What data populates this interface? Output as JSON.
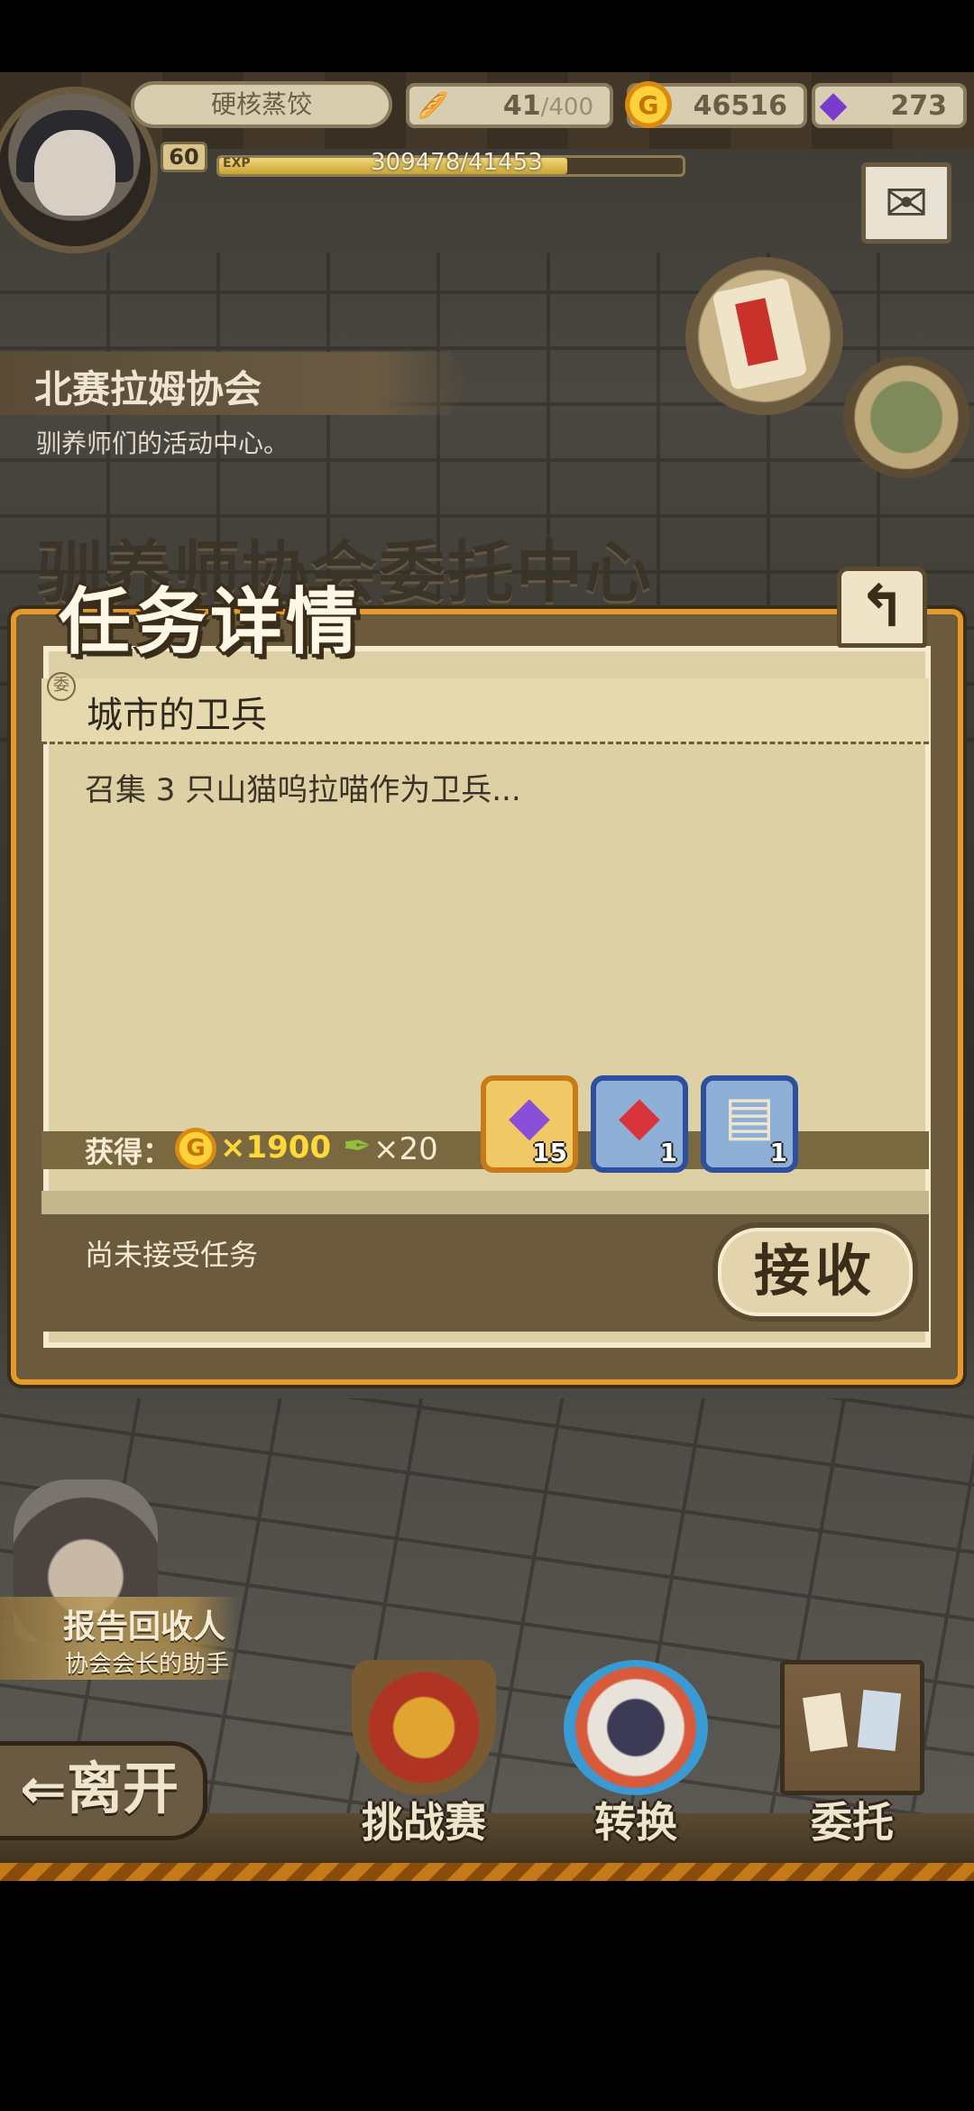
{
  "player": {
    "name": "硬核蒸饺",
    "level": "60",
    "exp_label": "EXP",
    "exp_text": "309478/41453",
    "exp_fraction": 0.75
  },
  "resources": {
    "stamina": {
      "icon": "bread-icon",
      "value": "41",
      "max": "/400"
    },
    "gold": {
      "icon": "gold-coin-icon",
      "symbol": "G",
      "value": "46516"
    },
    "gems": {
      "icon": "purple-gem-icon",
      "value": "273"
    }
  },
  "location": {
    "title": "北赛拉姆协会",
    "subtitle": "驯养师们的活动中心。"
  },
  "background_title": "驯养师协会委托中心",
  "dialog": {
    "title": "任务详情",
    "back_icon": "↰",
    "quest_icon": "委",
    "quest_name": "城市的卫兵",
    "quest_description": "召集 3 只山猫呜拉喵作为卫兵...",
    "reward_label": "获得：",
    "gold_symbol": "G",
    "gold_amount": "×1900",
    "feather_amount": "×20",
    "items": [
      {
        "name": "purple-crystal",
        "glyph": "◆",
        "count": "15",
        "color": "#8a4fd8"
      },
      {
        "name": "red-gem-fragment",
        "glyph": "◆",
        "count": "1",
        "color": "#d8343c"
      },
      {
        "name": "scroll",
        "glyph": "▤",
        "count": "1",
        "color": "#efe4cc"
      }
    ],
    "status": "尚未接受任务",
    "accept_label": "接收"
  },
  "npc": {
    "name": "报告回收人",
    "role": "协会会长的助手"
  },
  "nav": {
    "leave_label": "⇐离开",
    "challenge_label": "挑战赛",
    "convert_label": "转换",
    "commission_label": "委托"
  },
  "colors": {
    "dialog_border": "#e59a2b",
    "parchment": "#ddd0a4",
    "gold_text": "#ffd93a",
    "item_gold_border": "#c77a16",
    "item_blue_border": "#2d4f9e"
  }
}
